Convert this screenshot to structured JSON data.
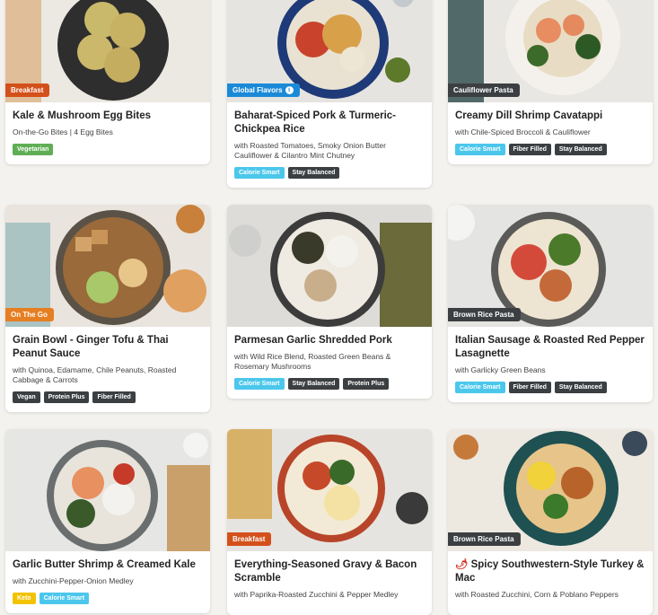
{
  "colors": {
    "breakfast": "#d4501b",
    "global": "#1a8ad8",
    "dark": "#3c3f42",
    "vegetarian": "#5fae55",
    "calorie_smart": "#4cc7ec",
    "keto": "#f2c300",
    "ontheg": "#e67e22"
  },
  "meals": [
    {
      "title": "Kale & Mushroom Egg Bites",
      "subtitle": "On-the-Go Bites | 4 Egg Bites",
      "tag": "Breakfast",
      "tag_color": "#d4501b",
      "badges": [
        {
          "label": "Vegetarian",
          "color": "#5fae55"
        }
      ]
    },
    {
      "title": "Baharat-Spiced Pork & Turmeric-Chickpea Rice",
      "subtitle": "with Roasted Tomatoes, Smoky Onion Butter Cauliflower & Cilantro Mint Chutney",
      "tag": "Global Flavors",
      "tag_color": "#1a8ad8",
      "badges": [
        {
          "label": "Calorie Smart",
          "color": "#4cc7ec"
        },
        {
          "label": "Stay Balanced",
          "color": "#3c3f42"
        }
      ]
    },
    {
      "title": "Creamy Dill Shrimp Cavatappi",
      "subtitle": "with Chile-Spiced Broccoli & Cauliflower",
      "tag": "Cauliflower Pasta",
      "tag_color": "#3c3f42",
      "badges": [
        {
          "label": "Calorie Smart",
          "color": "#4cc7ec"
        },
        {
          "label": "Fiber Filled",
          "color": "#3c3f42"
        },
        {
          "label": "Stay Balanced",
          "color": "#3c3f42"
        }
      ]
    },
    {
      "title": "Grain Bowl - Ginger Tofu & Thai Peanut Sauce",
      "subtitle": "with Quinoa, Edamame, Chile Peanuts, Roasted Cabbage & Carrots",
      "tag": "On The Go",
      "tag_color": "#e67e22",
      "badges": [
        {
          "label": "Vegan",
          "color": "#3c3f42"
        },
        {
          "label": "Protein Plus",
          "color": "#3c3f42"
        },
        {
          "label": "Fiber Filled",
          "color": "#3c3f42"
        }
      ]
    },
    {
      "title": "Parmesan Garlic Shredded Pork",
      "subtitle": "with Wild Rice Blend, Roasted Green Beans & Rosemary Mushrooms",
      "tag": "",
      "tag_color": "",
      "badges": [
        {
          "label": "Calorie Smart",
          "color": "#4cc7ec"
        },
        {
          "label": "Stay Balanced",
          "color": "#3c3f42"
        },
        {
          "label": "Protein Plus",
          "color": "#3c3f42"
        }
      ]
    },
    {
      "title": "Italian Sausage & Roasted Red Pepper Lasagnette",
      "subtitle": "with Garlicky Green Beans",
      "tag": "Brown Rice Pasta",
      "tag_color": "#3c3f42",
      "badges": [
        {
          "label": "Calorie Smart",
          "color": "#4cc7ec"
        },
        {
          "label": "Fiber Filled",
          "color": "#3c3f42"
        },
        {
          "label": "Stay Balanced",
          "color": "#3c3f42"
        }
      ]
    },
    {
      "title": "Garlic Butter Shrimp & Creamed Kale",
      "subtitle": "with Zucchini-Pepper-Onion Medley",
      "tag": "",
      "tag_color": "",
      "badges": [
        {
          "label": "Keto",
          "color": "#f2c300"
        },
        {
          "label": "Calorie Smart",
          "color": "#4cc7ec"
        }
      ]
    },
    {
      "title": "Everything-Seasoned Gravy & Bacon Scramble",
      "subtitle": "with Paprika-Roasted Zucchini & Pepper Medley",
      "tag": "Breakfast",
      "tag_color": "#d4501b",
      "badges": []
    },
    {
      "title": "Spicy Southwestern-Style Turkey & Mac",
      "subtitle": "with Roasted Zucchini, Corn & Poblano Peppers",
      "tag": "Brown Rice Pasta",
      "tag_color": "#3c3f42",
      "badges": [],
      "spicy_icon": "chili-pepper-icon"
    }
  ]
}
